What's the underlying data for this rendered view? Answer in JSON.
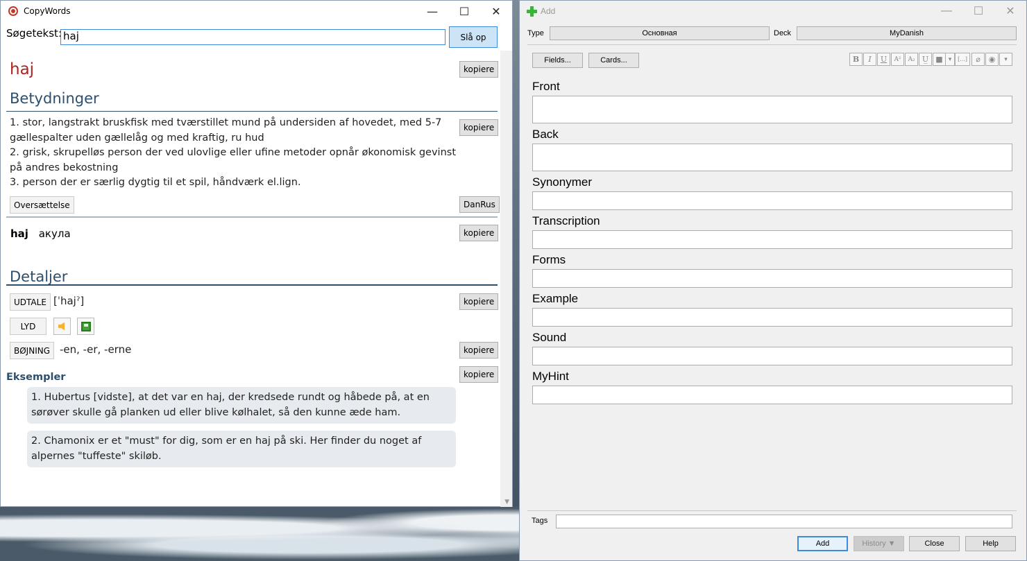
{
  "copywords": {
    "title": "CopyWords",
    "search_label": "Søgetekst:",
    "search_value": "haj",
    "lookup_label": "Slå op",
    "word": "haj",
    "copy_label": "kopiere",
    "meanings_heading": "Betydninger",
    "meanings": [
      "1. stor, langstrakt bruskfisk med tværstillet mund på undersiden af hovedet, med 5-7 gællespalter uden gællelåg og med kraftig, ru hud",
      "2. grisk, skrupelløs person der ved ulovlige eller ufine metoder opnår økonomisk gevinst på andres bekostning",
      "3. person der er særlig dygtig til et spil, håndværk el.lign."
    ],
    "translate_label": "Oversættelse",
    "dict_label": "DanRus",
    "translation_word": "haj",
    "translation_text": "акула",
    "details_heading": "Detaljer",
    "udtale_label": "UDTALE",
    "udtale_value": "[ˈhajˀ]",
    "lyd_label": "LYD",
    "bojning_label": "BØJNING",
    "bojning_value": "-en, -er, -erne",
    "examples_heading": "Eksempler",
    "examples": [
      "1. Hubertus [vidste], at det var en haj, der kredsede rundt og håbede på, at en sørøver skulle gå planken ud eller blive kølhalet, så den kunne æde ham.",
      "2. Chamonix er et \"must\" for dig, som er en haj på ski. Her finder du noget af alpernes \"tuffeste\" skiløb."
    ]
  },
  "anki": {
    "title": "Add",
    "type_label": "Type",
    "type_value": "Основная",
    "deck_label": "Deck",
    "deck_value": "MyDanish",
    "fields_btn": "Fields...",
    "cards_btn": "Cards...",
    "format_buttons": [
      "B",
      "I",
      "U",
      "A²",
      "A₂",
      "U̲",
      "■",
      "▾",
      "[...]",
      "⌀",
      "◉",
      "▾"
    ],
    "fields": [
      "Front",
      "Back",
      "Synonymer",
      "Transcription",
      "Forms",
      "Example",
      "Sound",
      "MyHint"
    ],
    "tags_label": "Tags",
    "add_btn": "Add",
    "history_btn": "History ▼",
    "close_btn": "Close",
    "help_btn": "Help"
  },
  "window_controls": {
    "minimize": "—",
    "maximize": "☐",
    "close": "✕"
  }
}
